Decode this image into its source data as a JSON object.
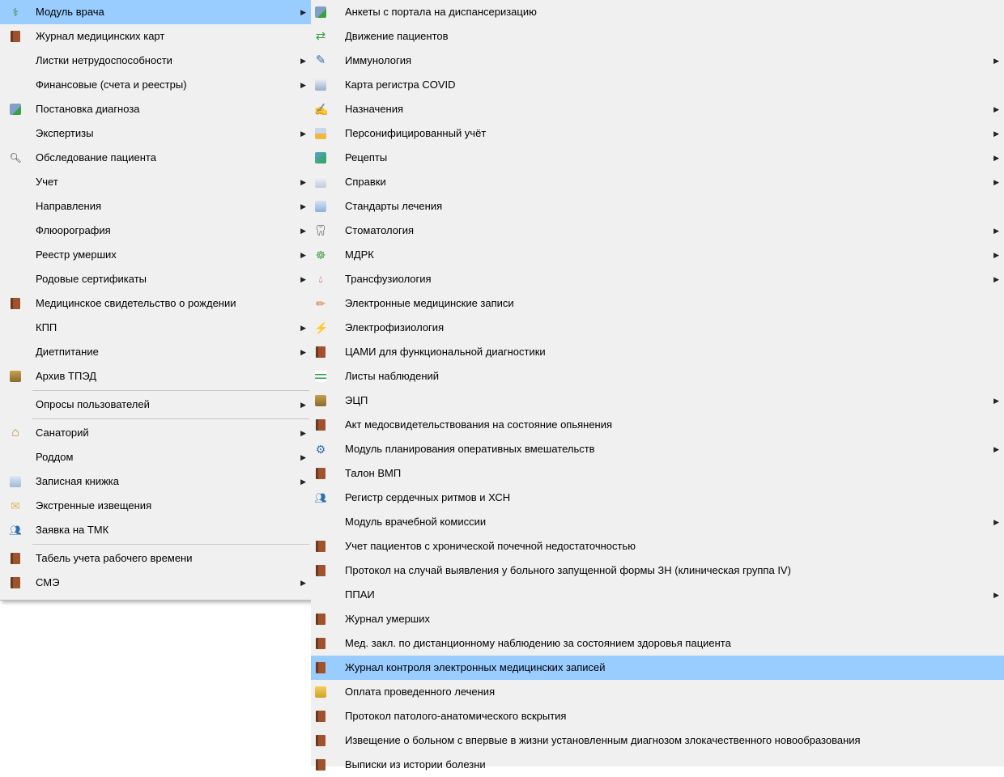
{
  "left_menu": {
    "items": [
      {
        "label": "Модуль врача",
        "icon": "doctor-icon",
        "submenu": true,
        "highlight": true
      },
      {
        "label": "Журнал медицинских карт",
        "icon": "book-icon",
        "submenu": false
      },
      {
        "label": "Листки нетрудоспособности",
        "icon": "",
        "submenu": true
      },
      {
        "label": "Финансовые (счета и реестры)",
        "icon": "",
        "submenu": true
      },
      {
        "label": "Постановка диагноза",
        "icon": "diagnosis-icon",
        "submenu": false
      },
      {
        "label": "Экспертизы",
        "icon": "",
        "submenu": true
      },
      {
        "label": "Обследование пациента",
        "icon": "search-icon",
        "submenu": false
      },
      {
        "label": "Учет",
        "icon": "",
        "submenu": true
      },
      {
        "label": "Направления",
        "icon": "",
        "submenu": true
      },
      {
        "label": "Флюорография",
        "icon": "",
        "submenu": true
      },
      {
        "label": "Реестр умерших",
        "icon": "",
        "submenu": true
      },
      {
        "label": "Родовые сертификаты",
        "icon": "",
        "submenu": true
      },
      {
        "label": "Медицинское свидетельство о рождении",
        "icon": "book-icon",
        "submenu": false
      },
      {
        "label": "КПП",
        "icon": "",
        "submenu": true
      },
      {
        "label": "Диетпитание",
        "icon": "",
        "submenu": true
      },
      {
        "label": "Архив ТПЭД",
        "icon": "archive-icon",
        "submenu": false
      },
      {
        "separator": true
      },
      {
        "label": "Опросы пользователей",
        "icon": "",
        "submenu": true
      },
      {
        "separator": true
      },
      {
        "label": "Санаторий",
        "icon": "house-icon",
        "submenu": true
      },
      {
        "label": "Роддом",
        "icon": "",
        "submenu": true
      },
      {
        "label": "Записная книжка",
        "icon": "notebook-icon",
        "submenu": true
      },
      {
        "label": "Экстренные извещения",
        "icon": "envelope-icon",
        "submenu": false
      },
      {
        "label": "Заявка на ТМК",
        "icon": "users-icon",
        "submenu": false
      },
      {
        "separator": true
      },
      {
        "label": "Табель учета рабочего времени",
        "icon": "book-icon",
        "submenu": false
      },
      {
        "label": "СМЭ",
        "icon": "book-icon",
        "submenu": true
      }
    ]
  },
  "right_menu": {
    "items": [
      {
        "label": "Анкеты с портала на диспансеризацию",
        "icon": "diagnosis-icon",
        "submenu": false
      },
      {
        "label": "Движение пациентов",
        "icon": "patient-move-icon",
        "submenu": false
      },
      {
        "label": "Иммунология",
        "icon": "syringe-icon",
        "submenu": true
      },
      {
        "label": "Карта регистра COVID",
        "icon": "clipboard-icon",
        "submenu": false
      },
      {
        "label": "Назначения",
        "icon": "prescription-icon",
        "submenu": true
      },
      {
        "label": "Персонифицированный учёт",
        "icon": "folder-icon",
        "submenu": true
      },
      {
        "label": "Рецепты",
        "icon": "recipe-icon",
        "submenu": true
      },
      {
        "label": "Справки",
        "icon": "document-icon",
        "submenu": true
      },
      {
        "label": "Стандарты лечения",
        "icon": "standards-icon",
        "submenu": false
      },
      {
        "label": "Стоматология",
        "icon": "tooth-icon",
        "submenu": true
      },
      {
        "label": "МДРК",
        "icon": "team-icon",
        "submenu": true
      },
      {
        "label": "Трансфузиология",
        "icon": "blood-drop-icon",
        "submenu": true
      },
      {
        "label": "Электронные медицинские записи",
        "icon": "edit-record-icon",
        "submenu": false
      },
      {
        "label": "Электрофизиология",
        "icon": "electro-icon",
        "submenu": false
      },
      {
        "label": "ЦАМИ для функциональной диагностики",
        "icon": "book-icon",
        "submenu": false
      },
      {
        "label": "Листы наблюдений",
        "icon": "sheet-icon",
        "submenu": false
      },
      {
        "label": "ЭЦП",
        "icon": "archive-icon",
        "submenu": true
      },
      {
        "label": "Акт медосвидетельствования на состояние опьянения",
        "icon": "book-icon",
        "submenu": false
      },
      {
        "label": "Модуль планирования оперативных вмешательств",
        "icon": "planning-icon",
        "submenu": true
      },
      {
        "label": "Талон ВМП",
        "icon": "book-icon",
        "submenu": false
      },
      {
        "label": "Регистр сердечных ритмов и ХСН",
        "icon": "users-icon",
        "submenu": false
      },
      {
        "label": "Модуль врачебной комиссии",
        "icon": "",
        "submenu": true
      },
      {
        "label": "Учет пациентов с хронической почечной недостаточностью",
        "icon": "book-icon",
        "submenu": false
      },
      {
        "label": "Протокол на случай выявления у больного запущенной формы ЗН (клиническая группа IV)",
        "icon": "book-icon",
        "submenu": false
      },
      {
        "label": "ППАИ",
        "icon": "",
        "submenu": true
      },
      {
        "label": "Журнал умерших",
        "icon": "book-icon",
        "submenu": false
      },
      {
        "label": "Мед. закл. по дистанционному наблюдению за состоянием здоровья пациента",
        "icon": "book-icon",
        "submenu": false
      },
      {
        "label": "Журнал контроля электронных медицинских записей",
        "icon": "book-icon",
        "submenu": false,
        "highlight": true
      },
      {
        "label": "Оплата проведенного лечения",
        "icon": "payment-folder-icon",
        "submenu": false
      },
      {
        "label": "Протокол патолого-анатомического вскрытия",
        "icon": "book-icon",
        "submenu": false
      },
      {
        "label": "Извещение о больном с впервые в жизни установленным диагнозом злокачественного новообразования",
        "icon": "book-icon",
        "submenu": false
      },
      {
        "label": "Выписки из истории болезни",
        "icon": "book-icon",
        "submenu": false
      }
    ]
  },
  "colors": {
    "menu_bg": "#f0f0f0",
    "highlight": "#99ccff",
    "separator": "#c8c8c8"
  }
}
